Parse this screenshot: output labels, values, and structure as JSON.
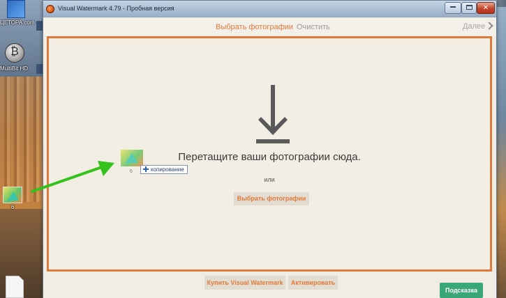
{
  "desktop": {
    "icons": [
      {
        "label": "ЦЕТОРА.com"
      },
      {
        "label": "MultiBit HD"
      },
      {
        "label": "6"
      }
    ]
  },
  "window": {
    "title": "Visual Watermark 4.79 - Пробная версия",
    "controls": {
      "close": "✕"
    }
  },
  "toolbar": {
    "select_photos": "Выбрать фотографии",
    "clear": "Очистить",
    "next": "Далее"
  },
  "dropzone": {
    "instruction": "Перетащите ваши фотографии сюда.",
    "or": "или",
    "select_button": "Выбрать фотографии"
  },
  "drag": {
    "file_label": "6",
    "copy_badge": "копирование"
  },
  "bottom": {
    "buy": "Купить Visual Watermark",
    "activate": "Активировать",
    "help": "Подсказка"
  },
  "colors": {
    "accent": "#e07a3a",
    "help_green": "#3aa777",
    "arrow_green": "#36c21c"
  }
}
